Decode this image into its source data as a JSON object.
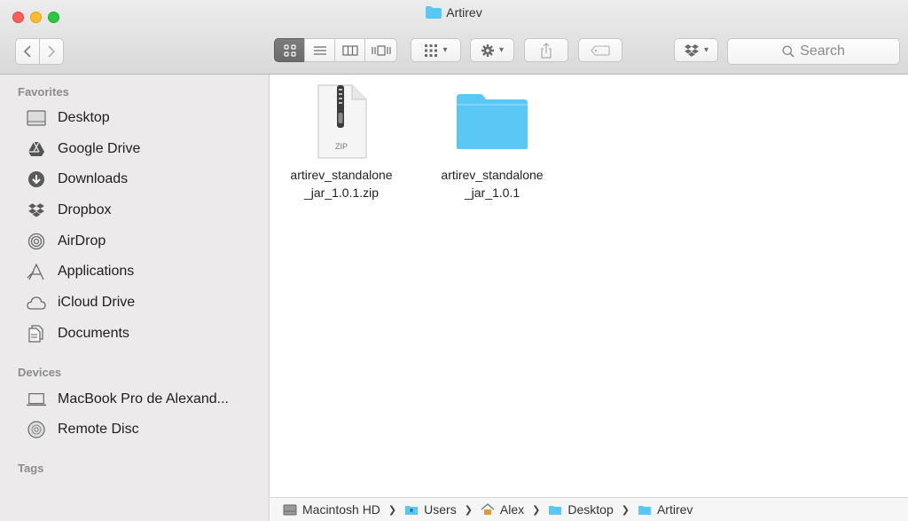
{
  "window": {
    "title": "Artirev"
  },
  "toolbar": {
    "back_icon": "chevron-left-icon",
    "forward_icon": "chevron-right-icon",
    "view_modes": [
      "icon-view",
      "list-view",
      "column-view",
      "cover-flow-view"
    ],
    "active_view": "icon-view",
    "search_placeholder": "Search"
  },
  "sidebar": {
    "favorites_heading": "Favorites",
    "favorites": [
      {
        "label": "Desktop",
        "icon": "desktop-icon"
      },
      {
        "label": "Google Drive",
        "icon": "google-drive-icon"
      },
      {
        "label": "Downloads",
        "icon": "downloads-icon"
      },
      {
        "label": "Dropbox",
        "icon": "dropbox-icon"
      },
      {
        "label": "AirDrop",
        "icon": "airdrop-icon"
      },
      {
        "label": "Applications",
        "icon": "applications-icon"
      },
      {
        "label": "iCloud Drive",
        "icon": "icloud-icon"
      },
      {
        "label": "Documents",
        "icon": "documents-icon"
      }
    ],
    "devices_heading": "Devices",
    "devices": [
      {
        "label": "MacBook Pro de Alexand...",
        "icon": "laptop-icon"
      },
      {
        "label": "Remote Disc",
        "icon": "disc-icon"
      }
    ],
    "tags_heading": "Tags"
  },
  "files": [
    {
      "name": "artirev_standalone\n_jar_1.0.1.zip",
      "kind": "zip",
      "badge": "ZIP"
    },
    {
      "name": "artirev_standalone\n_jar_1.0.1",
      "kind": "folder"
    }
  ],
  "pathbar": [
    "Macintosh HD",
    "Users",
    "Alex",
    "Desktop",
    "Artirev"
  ],
  "colors": {
    "folder_blue": "#5ac8f5",
    "sidebar_bg": "#eceaea",
    "active_segment": "#707070"
  }
}
